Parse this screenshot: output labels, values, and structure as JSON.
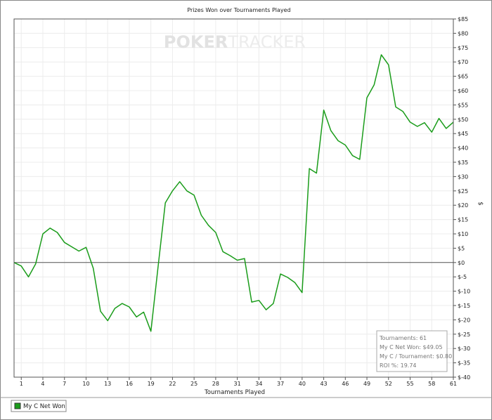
{
  "chart_data": {
    "type": "line",
    "title": "Prizes Won over Tournaments Played",
    "xlabel": "Tournaments Played",
    "ylabel": "$",
    "watermark": {
      "bold": "POKER",
      "light": "TRACKER"
    },
    "xlim": [
      0,
      61
    ],
    "ylim": [
      -40,
      85
    ],
    "y_step": 5,
    "x_ticks": [
      1,
      4,
      7,
      10,
      13,
      16,
      19,
      22,
      25,
      28,
      31,
      34,
      37,
      40,
      43,
      46,
      49,
      52,
      55,
      58,
      61
    ],
    "y_ticks": [
      {
        "v": 85,
        "label": "$85"
      },
      {
        "v": 80,
        "label": "$80"
      },
      {
        "v": 75,
        "label": "$75"
      },
      {
        "v": 70,
        "label": "$70"
      },
      {
        "v": 65,
        "label": "$65"
      },
      {
        "v": 60,
        "label": "$60"
      },
      {
        "v": 55,
        "label": "$55"
      },
      {
        "v": 50,
        "label": "$50"
      },
      {
        "v": 45,
        "label": "$45"
      },
      {
        "v": 40,
        "label": "$40"
      },
      {
        "v": 35,
        "label": "$35"
      },
      {
        "v": 30,
        "label": "$30"
      },
      {
        "v": 25,
        "label": "$25"
      },
      {
        "v": 20,
        "label": "$20"
      },
      {
        "v": 15,
        "label": "$15"
      },
      {
        "v": 10,
        "label": "$10"
      },
      {
        "v": 5,
        "label": "$5"
      },
      {
        "v": 0,
        "label": "$0"
      },
      {
        "v": -5,
        "label": "$-5"
      },
      {
        "v": -10,
        "label": "$-10"
      },
      {
        "v": -15,
        "label": "$-15"
      },
      {
        "v": -20,
        "label": "$-20"
      },
      {
        "v": -25,
        "label": "$-25"
      },
      {
        "v": -30,
        "label": "$-30"
      },
      {
        "v": -35,
        "label": "$-35"
      },
      {
        "v": -40,
        "label": "$-40"
      }
    ],
    "grid": true,
    "legend_position": "bottom-left",
    "series": [
      {
        "name": "My C Net Won",
        "color": "#1a9c1a",
        "x": [
          0,
          1,
          2,
          3,
          4,
          5,
          6,
          7,
          8,
          9,
          10,
          11,
          12,
          13,
          14,
          15,
          16,
          17,
          18,
          19,
          20,
          21,
          22,
          23,
          24,
          25,
          26,
          27,
          28,
          29,
          30,
          31,
          32,
          33,
          34,
          35,
          36,
          37,
          38,
          39,
          40,
          41,
          42,
          43,
          44,
          45,
          46,
          47,
          48,
          49,
          50,
          51,
          52,
          53,
          54,
          55,
          56,
          57,
          58,
          59,
          60,
          61
        ],
        "y": [
          0,
          -1.2,
          -5,
          -0.5,
          10,
          12,
          10.5,
          7,
          5.5,
          4,
          5.3,
          -2,
          -17,
          -20.3,
          -16,
          -14.3,
          -15.5,
          -19,
          -17.3,
          -24,
          -1.5,
          20.8,
          25,
          28.2,
          25,
          23.5,
          16.5,
          13,
          10.5,
          3.8,
          2.4,
          0.8,
          1.4,
          -13.8,
          -13.2,
          -16.5,
          -14.3,
          -4,
          -5.2,
          -7,
          -10.5,
          32.8,
          31.2,
          53.2,
          46,
          42.5,
          41,
          37.3,
          36,
          57.5,
          62,
          72.5,
          69,
          54.3,
          52.7,
          49,
          47.5,
          48.8,
          45.5,
          50.3,
          46.8,
          49
        ]
      }
    ]
  },
  "stats": [
    "Tournaments: 61",
    "My C Net Won: $49.05",
    "My C / Tournament: $0.80",
    "ROI %: 19.74"
  ]
}
